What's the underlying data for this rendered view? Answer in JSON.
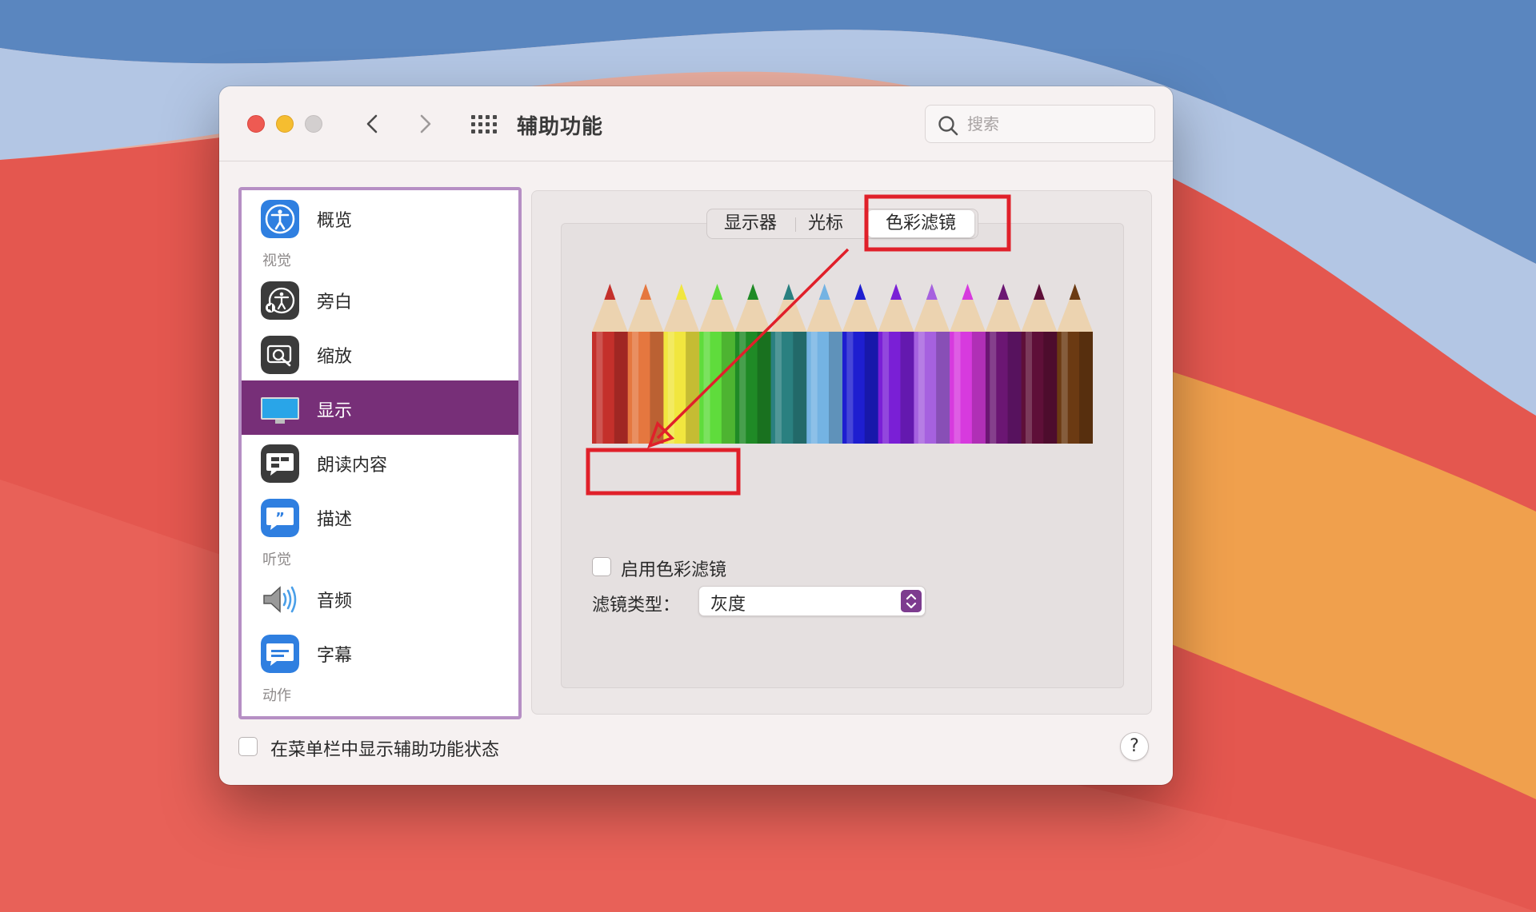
{
  "window": {
    "title": "辅助功能",
    "search_placeholder": "搜索"
  },
  "toolbar": {
    "back_icon": "chevron-left-icon",
    "forward_icon": "chevron-right-icon",
    "grid_icon": "grid-icon"
  },
  "sidebar": {
    "items": [
      {
        "label": "概览",
        "icon": "accessibility-icon"
      },
      {
        "label": "旁白",
        "icon": "voiceover-icon"
      },
      {
        "label": "缩放",
        "icon": "zoom-icon"
      },
      {
        "label": "显示",
        "icon": "display-icon",
        "selected": true
      },
      {
        "label": "朗读内容",
        "icon": "spoken-content-icon"
      },
      {
        "label": "描述",
        "icon": "descriptions-icon"
      },
      {
        "label": "音频",
        "icon": "speaker-icon"
      },
      {
        "label": "字幕",
        "icon": "captions-icon"
      }
    ],
    "sections": {
      "vision": "视觉",
      "hearing": "听觉",
      "motor": "动作"
    }
  },
  "tabs": [
    {
      "label": "显示器"
    },
    {
      "label": "光标"
    },
    {
      "label": "色彩滤镜",
      "selected": true
    }
  ],
  "color_filter": {
    "enable_label": "启用色彩滤镜",
    "enabled": false,
    "type_label": "滤镜类型：",
    "type_value": "灰度"
  },
  "footer": {
    "menu_bar_label": "在菜单栏中显示辅助功能状态",
    "menu_bar_checked": false,
    "help_label": "?"
  },
  "colors": {
    "accent": "#772f78",
    "annotation": "#e0202a",
    "sidebar_border": "#b68fc4"
  }
}
